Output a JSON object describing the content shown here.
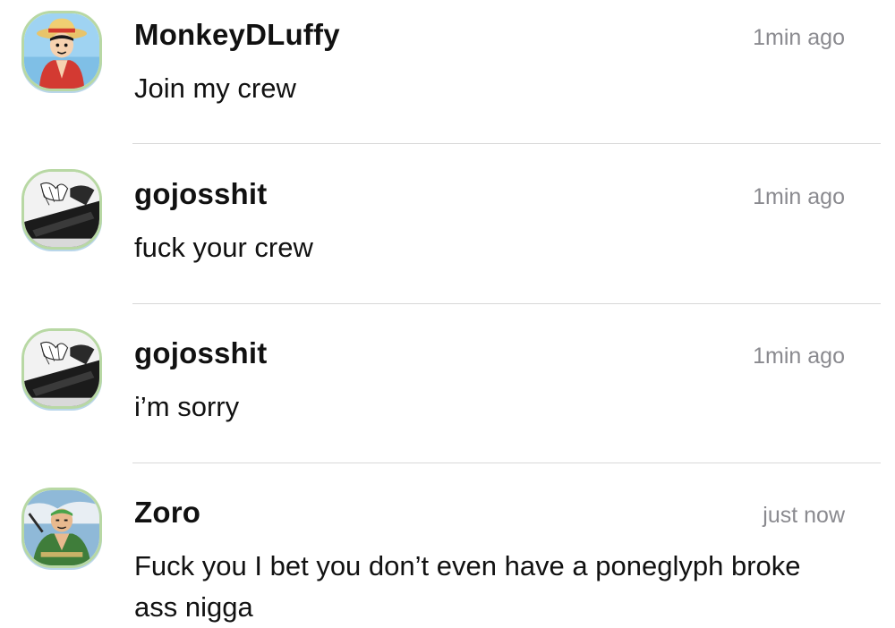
{
  "messages": [
    {
      "username": "MonkeyDLuffy",
      "time": "1min ago",
      "text": "Join my crew",
      "avatar_icon": "luffy-avatar-icon"
    },
    {
      "username": "gojosshit",
      "time": "1min ago",
      "text": "fuck your crew",
      "avatar_icon": "manga-avatar-icon"
    },
    {
      "username": "gojosshit",
      "time": "1min ago",
      "text": "i’m sorry",
      "avatar_icon": "manga-avatar-icon"
    },
    {
      "username": "Zoro",
      "time": "just now",
      "text": "Fuck you I bet you don’t even have a poneglyph broke ass nigga",
      "avatar_icon": "zoro-avatar-icon"
    }
  ],
  "colors": {
    "divider": "#d8d8d8",
    "timestamp": "#8a8a8f",
    "avatar_border": "#b8d8a4"
  }
}
